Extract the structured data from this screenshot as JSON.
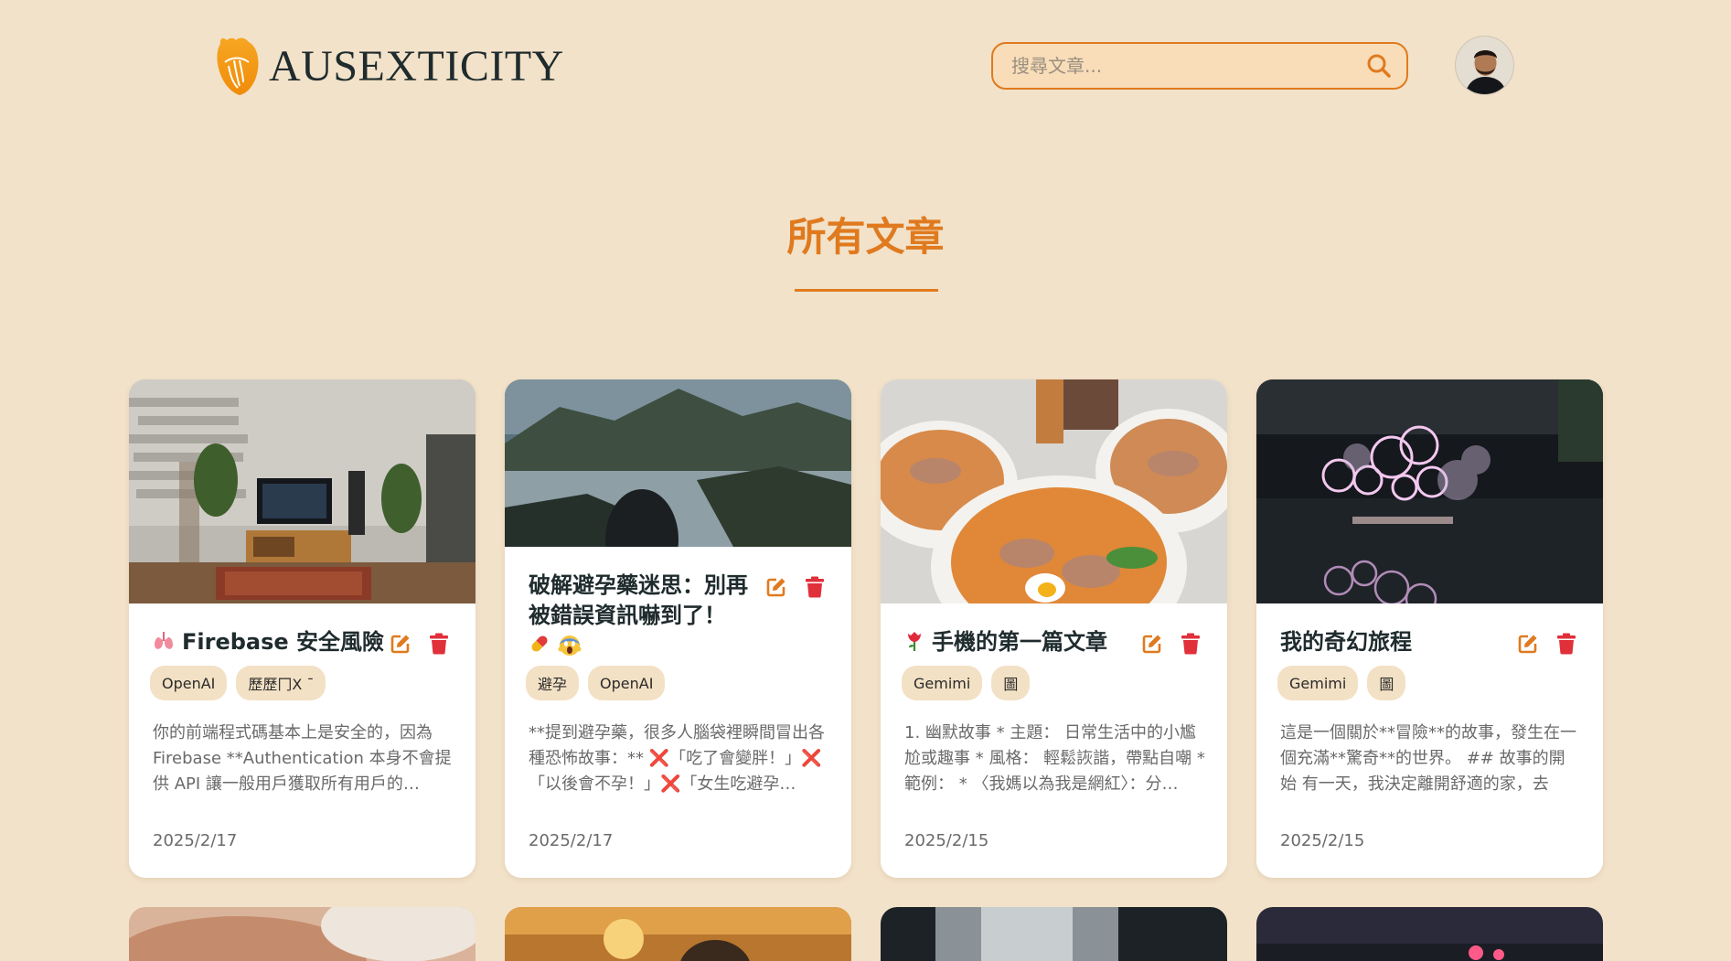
{
  "header": {
    "brand": "AUSEXTICITY",
    "search_placeholder": "搜尋文章...",
    "search_value": "",
    "icons": {
      "logo": "heart-logo-icon",
      "search": "search-icon",
      "avatar": "user-avatar"
    }
  },
  "page": {
    "title": "所有文章"
  },
  "colors": {
    "accent": "#e07a1f",
    "background": "#f2e2c9",
    "delete": "#e0303a",
    "tag_bg": "#f3e1c5"
  },
  "articles": [
    {
      "title": "Firebase 安全風險",
      "title_icon": "lungs-icon",
      "tags": [
        "OpenAI",
        "歷歷冂X ¯"
      ],
      "excerpt": "你的前端程式碼基本上是安全的，因為 Firebase **Authentication 本身不會提供 API 讓一般用戶獲取所有用戶的…",
      "date": "2025/2/17",
      "image": "living-room-tv-photo"
    },
    {
      "title": "破解避孕藥迷思：別再被錯誤資訊嚇到了！",
      "title_icons": [
        "pill-icon",
        "scream-face-icon"
      ],
      "tags": [
        "避孕",
        "OpenAI"
      ],
      "excerpt": "**提到避孕藥，很多人腦袋裡瞬間冒出各種恐怖故事：** ❌「吃了會變胖！」❌「以後會不孕！」❌「女生吃避孕…",
      "date": "2025/2/17",
      "image": "lake-mountain-photo"
    },
    {
      "title": "手機的第一篇文章",
      "title_icon": "rose-icon",
      "tags": [
        "Gemimi",
        "圖"
      ],
      "excerpt": "1. 幽默故事 * 主題： 日常生活中的小尷尬或趣事 * 風格： 輕鬆詼諧，帶點自嘲 * 範例： * 〈我媽以為我是網紅〉：分…",
      "date": "2025/2/15",
      "image": "noodle-bowls-photo"
    },
    {
      "title": "我的奇幻旅程",
      "tags": [
        "Gemimi",
        "圖"
      ],
      "excerpt": "這是一個關於**冒險**的故事，發生在一個充滿**驚奇**的世界。 ## 故事的開始 有一天，我決定離開舒適的家，去探…",
      "date": "2025/2/15",
      "image": "glowing-rings-night-photo"
    }
  ]
}
